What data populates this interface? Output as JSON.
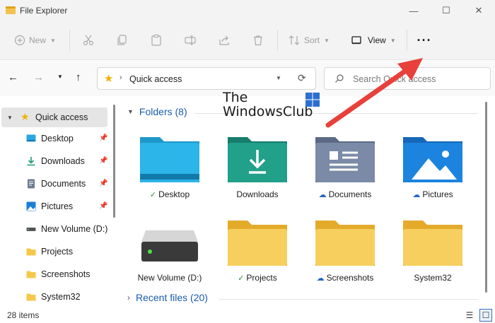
{
  "window": {
    "title": "File Explorer",
    "minimize": "—",
    "maximize": "☐",
    "close": "✕"
  },
  "toolbar": {
    "new_label": "New",
    "sort_label": "Sort",
    "view_label": "View",
    "more_label": "···"
  },
  "address": {
    "location": "Quick access"
  },
  "search": {
    "placeholder": "Search Quick access"
  },
  "sidebar": {
    "items": [
      {
        "label": "Quick access",
        "icon": "star-icon"
      },
      {
        "label": "Desktop",
        "icon": "desktop-icon",
        "pinned": true
      },
      {
        "label": "Downloads",
        "icon": "download-icon",
        "pinned": true
      },
      {
        "label": "Documents",
        "icon": "document-icon",
        "pinned": true
      },
      {
        "label": "Pictures",
        "icon": "picture-icon",
        "pinned": true
      },
      {
        "label": "New Volume (D:)",
        "icon": "drive-icon"
      },
      {
        "label": "Projects",
        "icon": "folder-icon"
      },
      {
        "label": "Screenshots",
        "icon": "folder-icon"
      },
      {
        "label": "System32",
        "icon": "folder-icon"
      }
    ]
  },
  "folders_section": {
    "label": "Folders (8)"
  },
  "recent_section": {
    "label": "Recent files (20)"
  },
  "folders": [
    {
      "label": "Desktop",
      "status": "✓",
      "icon": "desktop-folder-icon"
    },
    {
      "label": "Downloads",
      "status": "",
      "icon": "downloads-folder-icon"
    },
    {
      "label": "Documents",
      "status": "☁",
      "icon": "documents-folder-icon"
    },
    {
      "label": "Pictures",
      "status": "☁",
      "icon": "pictures-folder-icon"
    },
    {
      "label": "New Volume (D:)",
      "status": "",
      "icon": "drive-icon"
    },
    {
      "label": "Projects",
      "status": "✓",
      "icon": "folder-icon"
    },
    {
      "label": "Screenshots",
      "status": "☁",
      "icon": "folder-icon"
    },
    {
      "label": "System32",
      "status": "",
      "icon": "folder-icon"
    }
  ],
  "statusbar": {
    "count": "28 items"
  },
  "watermark": {
    "line1": "The",
    "line2": "WindowsClub"
  },
  "colors": {
    "accent": "#1b5bab",
    "arrow": "#e8403a",
    "folder_yellow": "#f5c84a",
    "folder_blue": "#1c7fd6",
    "folder_teal": "#1f9b88"
  }
}
